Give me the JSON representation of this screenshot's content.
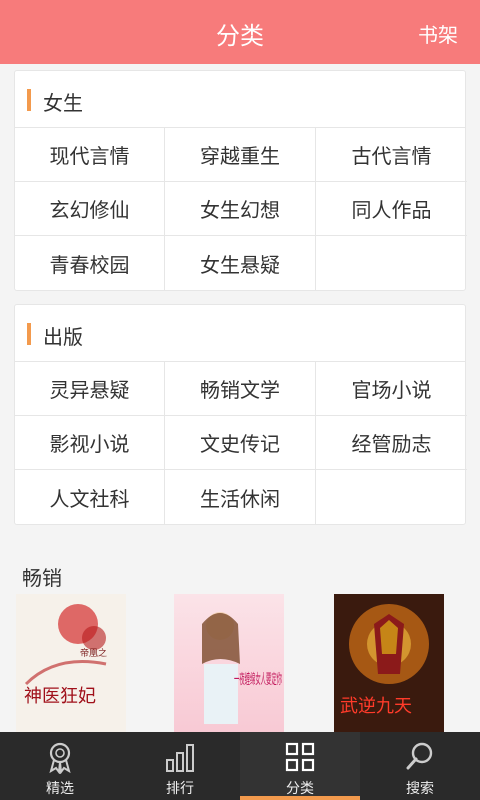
{
  "header": {
    "title": "分类",
    "shelf_label": "书架"
  },
  "female": {
    "heading": "女生",
    "items": [
      "现代言情",
      "穿越重生",
      "古代言情",
      "玄幻修仙",
      "女生幻想",
      "同人作品",
      "青春校园",
      "女生悬疑"
    ]
  },
  "publish": {
    "heading": "出版",
    "items": [
      "灵异悬疑",
      "畅销文学",
      "官场小说",
      "影视小说",
      "文史传记",
      "经管励志",
      "人文社科",
      "生活休闲"
    ]
  },
  "hot": {
    "heading": "畅销",
    "books": [
      {
        "cover_text": "神医狂妃",
        "cover_subtext": "帝凰之"
      },
      {
        "cover_text": "一夜缠绵女人要定你",
        "cover_subtext": ""
      },
      {
        "cover_text": "武逆九天",
        "cover_subtext": ""
      }
    ]
  },
  "tabbar": {
    "tabs": [
      {
        "label": "精选",
        "icon": "medal-icon"
      },
      {
        "label": "排行",
        "icon": "bar-chart-icon"
      },
      {
        "label": "分类",
        "icon": "grid-icon"
      },
      {
        "label": "搜索",
        "icon": "search-icon"
      }
    ],
    "active": "分类"
  },
  "colors": {
    "header": "#f77b7b",
    "accent": "#f39a4d",
    "tabbar": "#2a2a2a"
  }
}
